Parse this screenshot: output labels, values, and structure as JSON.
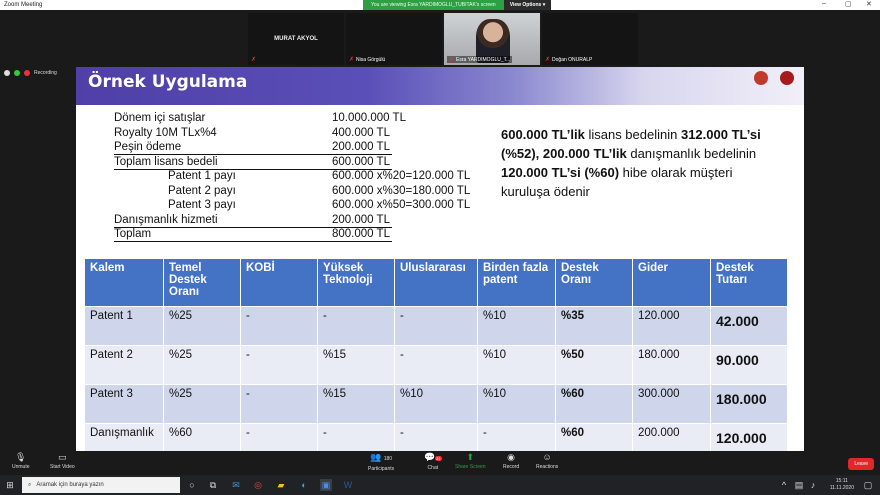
{
  "window": {
    "title": "Zoom Meeting"
  },
  "banner": {
    "message": "You are viewing Esra YARDIMOGLU_TUBITAK's screen",
    "options": "View Options"
  },
  "recording": {
    "label": "Recording"
  },
  "participants": [
    {
      "name": "MURAT AKYOL",
      "label": ""
    },
    {
      "name": "",
      "label": "Nisa Görgülü"
    },
    {
      "name": "",
      "label": "Esra YARDIMOGLU_T..."
    },
    {
      "name": "",
      "label": "Doğan ONURALP"
    }
  ],
  "slide": {
    "title": "Örnek Uygulama",
    "lines": [
      {
        "label": "Dönem içi satışlar",
        "value": "10.000.000 TL"
      },
      {
        "label": "Royalty 10M TLx%4",
        "value": "400.000 TL"
      },
      {
        "label": "Peşin ödeme",
        "value": "200.000 TL"
      },
      {
        "label": "Toplam lisans bedeli",
        "value": "600.000 TL"
      },
      {
        "label": "Patent 1 payı",
        "value": "600.000 x%20=120.000 TL"
      },
      {
        "label": "Patent 2 payı",
        "value": "600.000 x%30=180.000 TL"
      },
      {
        "label": "Patent 3 payı",
        "value": "600.000 x%50=300.000 TL"
      },
      {
        "label": "Danışmanlık hizmeti",
        "value": "200.000 TL"
      },
      {
        "label": "Toplam",
        "value": "800.000 TL"
      }
    ],
    "summary": {
      "p1": "600.000 TL’lik",
      "p2": " lisans bedelinin ",
      "p3": "312.000 TL’si (%52), 200.000 TL’lik",
      "p4": " danışmanlık bedelinin ",
      "p5": "120.000 TL’si (%60)",
      "p6": " hibe olarak müşteri kuruluşa ödenir"
    },
    "table": {
      "headers": [
        "Kalem",
        "Temel Destek Oranı",
        "KOBİ",
        "Yüksek Teknoloji",
        "Uluslararası",
        "Birden fazla patent",
        "Destek Oranı",
        "Gider",
        "Destek Tutarı"
      ],
      "rows": [
        [
          "Patent 1",
          "%25",
          "-",
          "-",
          "-",
          "%10",
          "%35",
          "120.000",
          "42.000"
        ],
        [
          "Patent 2",
          "%25",
          "-",
          "%15",
          "-",
          "%10",
          "%50",
          "180.000",
          "90.000"
        ],
        [
          "Patent 3",
          "%25",
          "-",
          "%15",
          "%10",
          "%10",
          "%60",
          "300.000",
          "180.000"
        ],
        [
          "Danışmanlık",
          "%60",
          "-",
          "-",
          "-",
          "-",
          "%60",
          "200.000",
          "120.000"
        ]
      ]
    }
  },
  "toolbar": {
    "unmute": "Unmute",
    "start_video": "Start Video",
    "participants": "Participants",
    "participants_count": "180",
    "chat": "Chat",
    "chat_badge": "21",
    "share": "Share Screen",
    "record": "Record",
    "reactions": "Reactions",
    "leave": "Leave"
  },
  "taskbar": {
    "search_placeholder": "Aramak için buraya yazın",
    "time": "15:11",
    "date": "11.11.2020"
  }
}
